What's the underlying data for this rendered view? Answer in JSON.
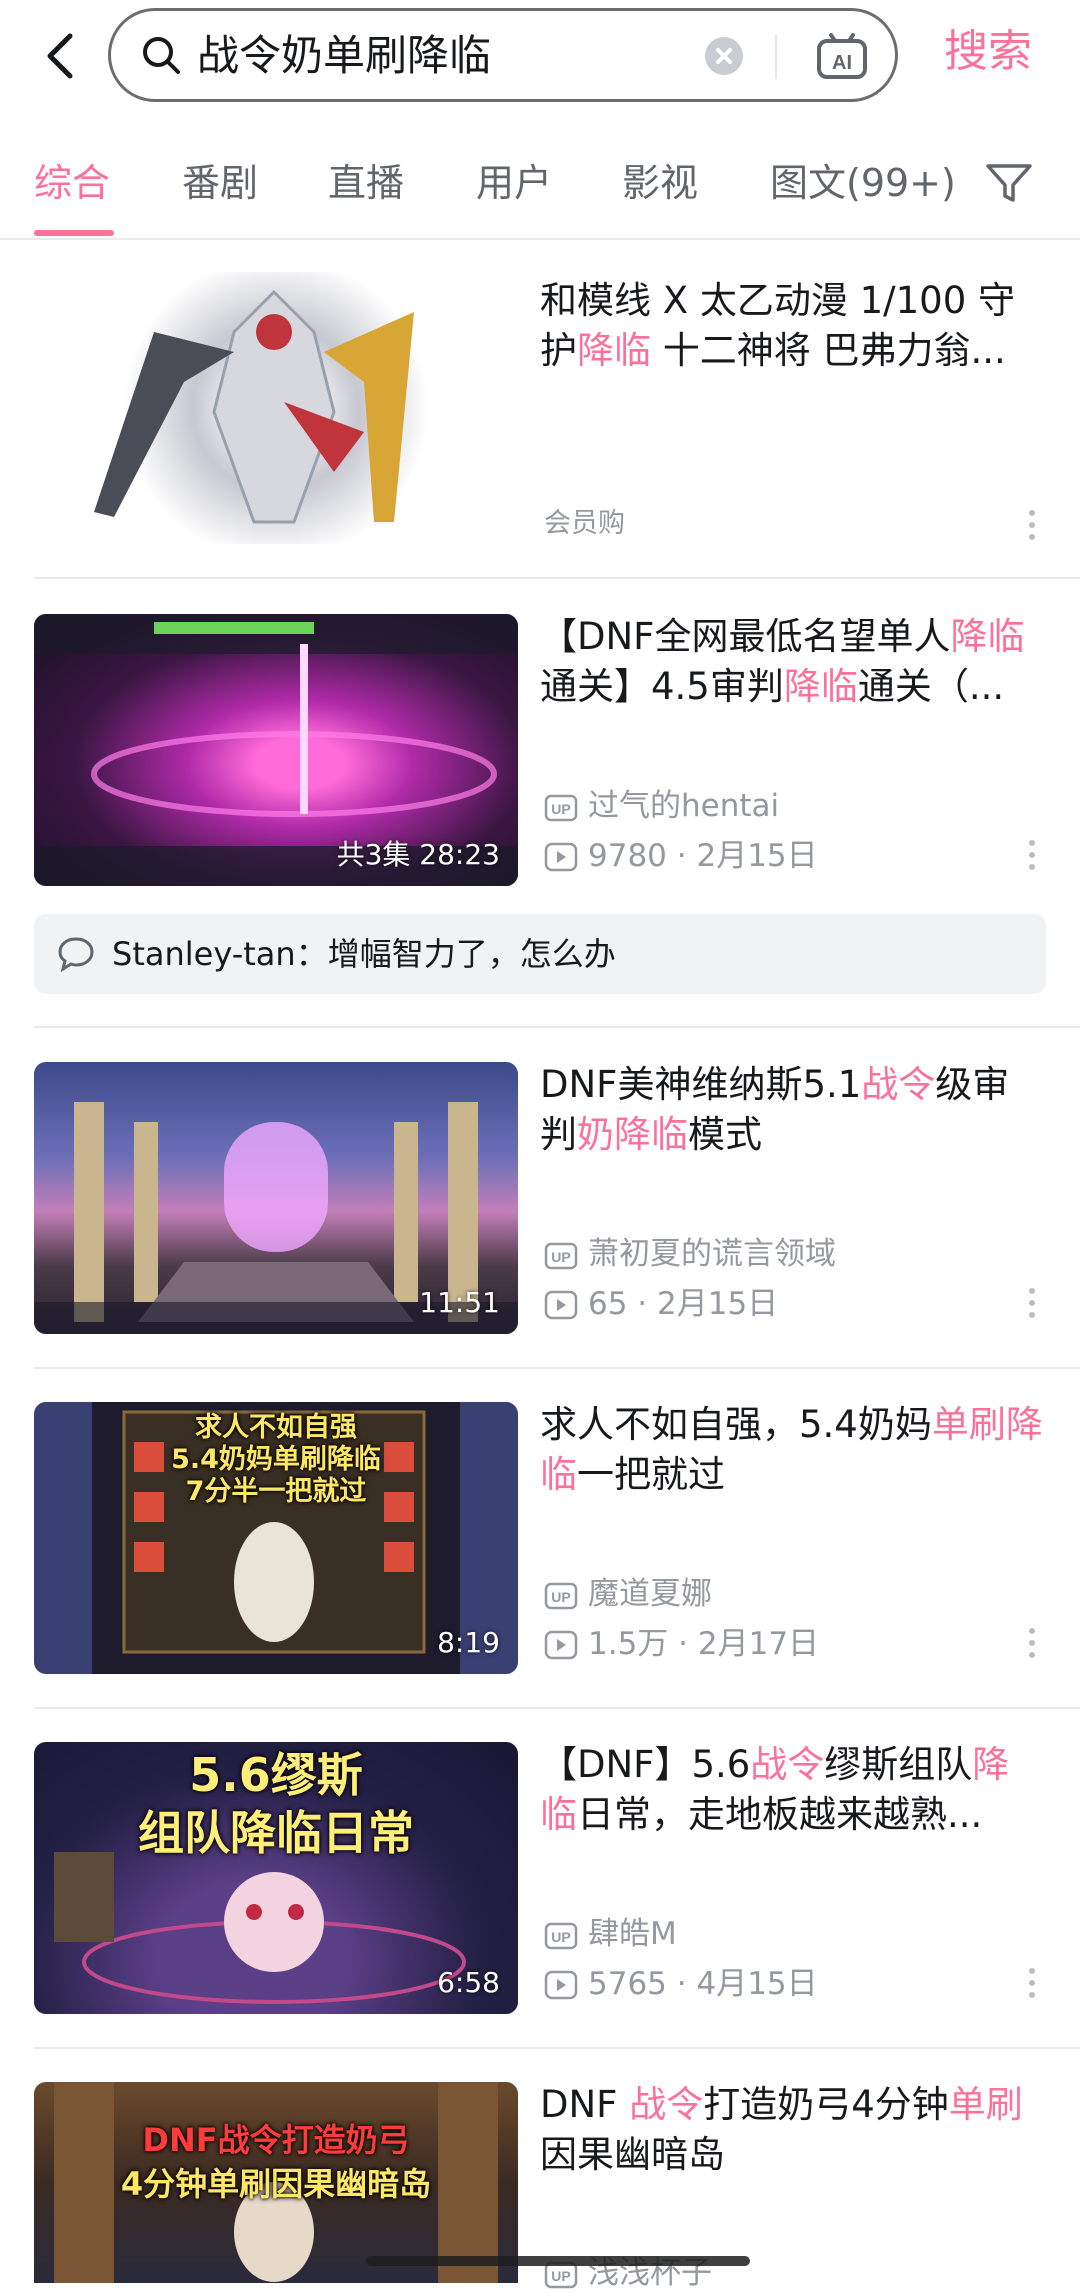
{
  "search": {
    "query": "战令奶单刷降临",
    "submit_label": "搜索",
    "ai_label": "AI"
  },
  "tabs": [
    {
      "label": "综合",
      "active": true
    },
    {
      "label": "番剧",
      "active": false
    },
    {
      "label": "直播",
      "active": false
    },
    {
      "label": "用户",
      "active": false
    },
    {
      "label": "影视",
      "active": false
    },
    {
      "label": "图文(99+)",
      "active": false
    }
  ],
  "colors": {
    "accent": "#fb7299",
    "text": "#18191c",
    "meta": "#9499a0"
  },
  "results": [
    {
      "kind": "product",
      "title_parts": [
        {
          "text": "和模线 X 太乙动漫 1/100 守护",
          "hl": false
        },
        {
          "text": "降临",
          "hl": true
        },
        {
          "text": " 十二神将 巴弗力翁...",
          "hl": false
        }
      ],
      "tag": "会员购"
    },
    {
      "kind": "video",
      "title_parts": [
        {
          "text": "【DNF全网最低名望单人",
          "hl": false
        },
        {
          "text": "降临",
          "hl": true
        },
        {
          "text": "通关】4.5审判",
          "hl": false
        },
        {
          "text": "降临",
          "hl": true
        },
        {
          "text": "通关（...",
          "hl": false
        }
      ],
      "duration": "共3集 28:23",
      "up": "过气的hentai",
      "plays": "9780",
      "date": "2月15日",
      "comment": "Stanley-tan：增幅智力了，怎么办"
    },
    {
      "kind": "video",
      "title_parts": [
        {
          "text": "DNF美神维纳斯5.1",
          "hl": false
        },
        {
          "text": "战令",
          "hl": true
        },
        {
          "text": "级审判",
          "hl": false
        },
        {
          "text": "奶降临",
          "hl": true
        },
        {
          "text": "模式",
          "hl": false
        }
      ],
      "duration": "11:51",
      "up": "萧初夏的谎言领域",
      "plays": "65",
      "date": "2月15日"
    },
    {
      "kind": "video",
      "title_parts": [
        {
          "text": "求人不如自强，5.4奶妈",
          "hl": false
        },
        {
          "text": "单刷降临",
          "hl": true
        },
        {
          "text": "一把就过",
          "hl": false
        }
      ],
      "duration": "8:19",
      "up": "魔道夏娜",
      "plays": "1.5万",
      "date": "2月17日",
      "thumb_caption": [
        "求人不如自强",
        "5.4奶妈单刷降临",
        "7分半一把就过"
      ]
    },
    {
      "kind": "video",
      "title_parts": [
        {
          "text": "【DNF】5.6",
          "hl": false
        },
        {
          "text": "战令",
          "hl": true
        },
        {
          "text": "缪斯组队",
          "hl": false
        },
        {
          "text": "降临",
          "hl": true
        },
        {
          "text": "日常，走地板越来越熟...",
          "hl": false
        }
      ],
      "duration": "6:58",
      "up": "肆皓M",
      "plays": "5765",
      "date": "4月15日",
      "thumb_caption": [
        "5.6缪斯",
        "组队降临日常"
      ]
    },
    {
      "kind": "video",
      "title_parts": [
        {
          "text": "DNF ",
          "hl": false
        },
        {
          "text": "战令",
          "hl": true
        },
        {
          "text": "打造奶弓4分钟",
          "hl": false
        },
        {
          "text": "单刷",
          "hl": true
        },
        {
          "text": "因果幽暗岛",
          "hl": false
        }
      ],
      "up": "浅浅杯子",
      "thumb_caption": [
        "DNF战令打造奶弓",
        "4分钟单刷因果幽暗岛"
      ]
    }
  ]
}
